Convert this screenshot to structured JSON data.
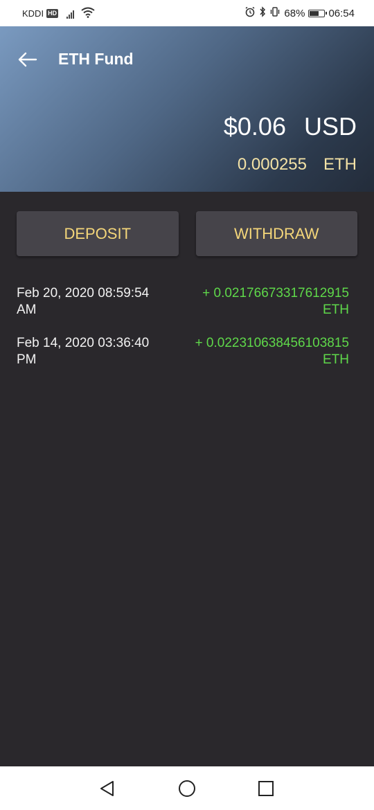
{
  "status_bar": {
    "carrier": "KDDI",
    "hd_badge": "HD",
    "battery_percent": "68%",
    "battery_level": 0.68,
    "time": "06:54"
  },
  "header": {
    "title": "ETH Fund",
    "back_icon": "arrow-left-icon",
    "balance_usd_value": "$0.06",
    "balance_usd_unit": "USD",
    "balance_eth_value": "0.000255",
    "balance_eth_unit": "ETH"
  },
  "actions": {
    "deposit_label": "DEPOSIT",
    "withdraw_label": "WITHDRAW"
  },
  "transactions": [
    {
      "date_line1": "Feb 20, 2020 08:59:54",
      "date_line2": "AM",
      "amount": "+ 0.02176673317612915",
      "unit": "ETH"
    },
    {
      "date_line1": "Feb 14, 2020 03:36:40",
      "date_line2": "PM",
      "amount": "+ 0.022310638456103815",
      "unit": "ETH"
    }
  ],
  "nav": {
    "back_icon": "triangle-back-icon",
    "home_icon": "circle-home-icon",
    "recents_icon": "square-recents-icon"
  },
  "colors": {
    "background": "#2a282c",
    "accent_yellow": "#f5d77a",
    "positive_green": "#5fd84a",
    "button_bg": "#46444a"
  }
}
